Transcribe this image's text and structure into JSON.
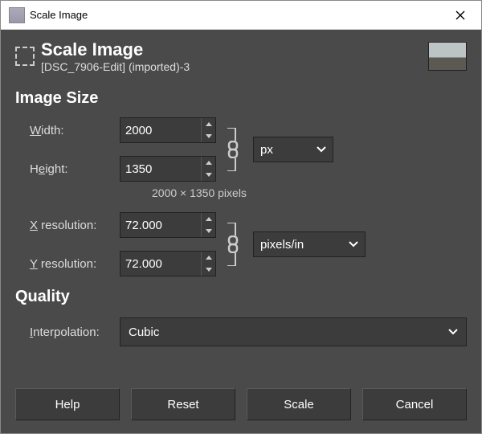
{
  "window": {
    "title": "Scale Image"
  },
  "header": {
    "title": "Scale Image",
    "subtitle": "[DSC_7906-Edit] (imported)-3"
  },
  "sections": {
    "image_size": "Image Size",
    "quality": "Quality"
  },
  "labels": {
    "width": "Width:",
    "width_u": "W",
    "width_rest": "idth:",
    "height": "Height:",
    "height_u": "e",
    "height_pre": "H",
    "height_rest": "ight:",
    "xres_u": "X",
    "xres_rest": " resolution:",
    "yres_u": "Y",
    "yres_rest": " resolution:",
    "interp_u": "I",
    "interp_pre": "",
    "interp_rest": "nterpolation:"
  },
  "values": {
    "width": "2000",
    "height": "1350",
    "xres": "72.000",
    "yres": "72.000",
    "size_unit": "px",
    "res_unit": "pixels/in",
    "interpolation": "Cubic"
  },
  "dims_text": "2000 × 1350 pixels",
  "buttons": {
    "help_u": "H",
    "help_rest": "elp",
    "reset_u": "R",
    "reset_rest": "eset",
    "scale_u": "S",
    "scale_rest": "cale",
    "cancel_u": "C",
    "cancel_rest": "ancel"
  }
}
